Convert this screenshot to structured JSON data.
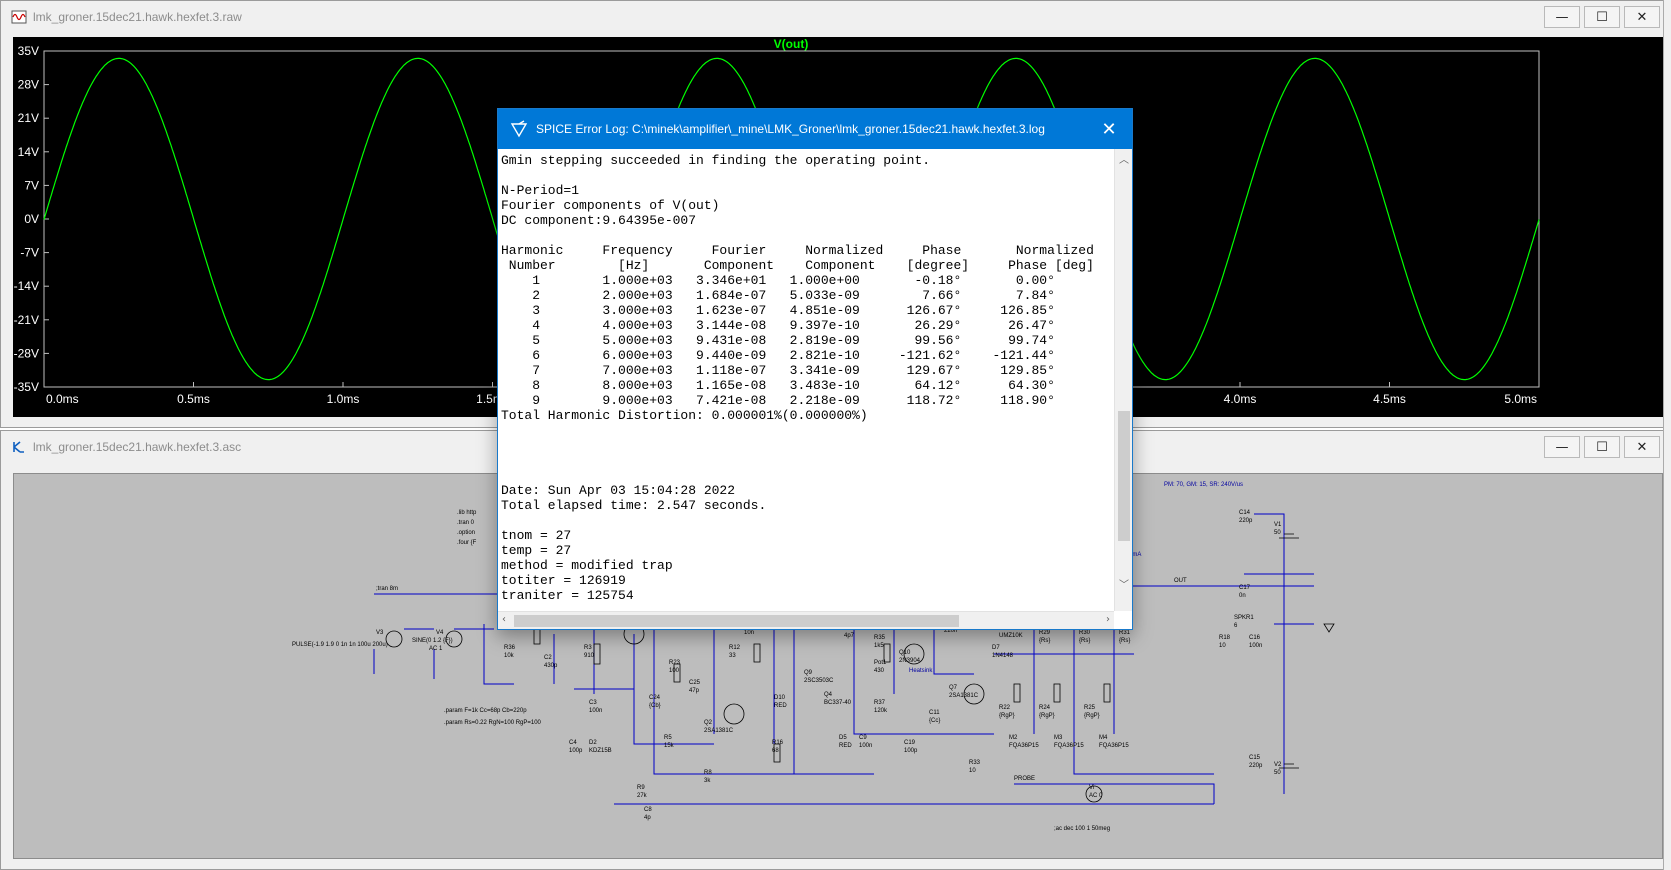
{
  "waveform_window": {
    "title": "lmk_groner.15dec21.hawk.hexfet.3.raw",
    "trace_label": "V(out)",
    "trace_color": "#00ff00",
    "y_ticks": [
      "35V",
      "28V",
      "21V",
      "14V",
      "7V",
      "0V",
      "-7V",
      "-14V",
      "-21V",
      "-28V",
      "-35V"
    ],
    "x_ticks": [
      "0.0ms",
      "0.5ms",
      "1.0ms",
      "1.5ms",
      "2.0ms",
      "2.5ms",
      "3.0ms",
      "3.5ms",
      "4.0ms",
      "4.5ms",
      "5.0ms"
    ]
  },
  "chart_data": {
    "type": "line",
    "title": "V(out)",
    "xlabel": "",
    "ylabel": "",
    "xlim": [
      0,
      5
    ],
    "ylim": [
      -35,
      35
    ],
    "x_unit": "ms",
    "y_unit": "V",
    "series": [
      {
        "name": "V(out)",
        "function": "sine",
        "amplitude": 33.46,
        "frequency_hz": 1000,
        "phase_deg": -0.18,
        "offset": 0,
        "color": "#00ff00"
      }
    ]
  },
  "schematic_window": {
    "title": "lmk_groner.15dec21.hawk.hexfet.3.asc",
    "labels": {
      "info": "PM: 70, GM: 15, SR: 240V/us",
      "tran": ";tran 8m",
      "pulse": "PULSE(-1.9 1.9 0 1n 1n 100u 200u)",
      "sine": "SINE(0 1.2 {F})",
      "ac1": "AC 1",
      "param1": ".param F=1k Cc=68p Cb=220p",
      "param2": ".param Rs=0.22 RgN=100 RgP=100",
      "acdec": ";ac dec 100 1 50meg",
      "out": "OUT",
      "probe": "PROBE",
      "heatsink": "Heatsink",
      "current": "40 mA",
      "lib": ".lib http",
      "tran0": ".tran 0",
      "options": ".option",
      "four": ".four {F"
    },
    "parts": [
      [
        "V3",
        ""
      ],
      [
        "V4",
        ""
      ],
      [
        "R36",
        "10k"
      ],
      [
        "C2",
        "430p"
      ],
      [
        "R3",
        "910"
      ],
      [
        "C3",
        "100n"
      ],
      [
        "C4",
        "100p"
      ],
      [
        "D2",
        "KDZ15B"
      ],
      [
        "Q13",
        "BC550C"
      ],
      [
        "R23",
        "100"
      ],
      [
        "C24",
        "{Cb}"
      ],
      [
        "R5",
        "15k"
      ],
      [
        "Q2",
        "2SA1381C"
      ],
      [
        "R12",
        "33"
      ],
      [
        "C25",
        "47p"
      ],
      [
        "R8",
        "3k"
      ],
      [
        "R9",
        "27k"
      ],
      [
        "C8",
        "4p"
      ],
      [
        "C12",
        "10n"
      ],
      [
        "D10",
        "RED"
      ],
      [
        "R16",
        "68"
      ],
      [
        "Q9",
        "2SC3503C"
      ],
      [
        "Q4",
        "BC337-40"
      ],
      [
        "D5",
        "RED"
      ],
      [
        "C9",
        "100n"
      ],
      [
        "C20",
        "4p7"
      ],
      [
        "R35",
        "1k5"
      ],
      [
        "Pot1",
        "430"
      ],
      [
        "Q5",
        ""
      ],
      [
        "Q10",
        "2N3904"
      ],
      [
        "R37",
        "120k"
      ],
      [
        "C11",
        "{Cc}"
      ],
      [
        "C19",
        "100p"
      ],
      [
        "C23",
        "220n"
      ],
      [
        "Q7",
        "2SA1381C"
      ],
      [
        "R33",
        "10"
      ],
      [
        "D9",
        "UMZ10K"
      ],
      [
        "D7",
        "1N4148"
      ],
      [
        "R29",
        "{Rs}"
      ],
      [
        "R30",
        "{Rs}"
      ],
      [
        "R31",
        "{Rs}"
      ],
      [
        "R22",
        "{RgP}"
      ],
      [
        "R24",
        "{RgP}"
      ],
      [
        "R25",
        "{RgP}"
      ],
      [
        "M2",
        "FQA36P15"
      ],
      [
        "M3",
        "FQA36P15"
      ],
      [
        "M4",
        "FQA36P15"
      ],
      [
        "M6",
        "FQA27N25"
      ],
      [
        "R27",
        "{RgN}"
      ],
      [
        "R28",
        "{Rs}"
      ],
      [
        "C14",
        "220p"
      ],
      [
        "V1",
        "50"
      ],
      [
        "C17",
        "0n"
      ],
      [
        "SPKR1",
        "6"
      ],
      [
        "R18",
        "10"
      ],
      [
        "C16",
        "100n"
      ],
      [
        "C15",
        "220p"
      ],
      [
        "V2",
        "50"
      ],
      [
        "Vi",
        "AC 0"
      ]
    ]
  },
  "error_log": {
    "title": "SPICE Error Log: C:\\minek\\amplifier\\_mine\\LMK_Groner\\lmk_groner.15dec21.hawk.hexfet.3.log",
    "lines": [
      "Gmin stepping succeeded in finding the operating point.",
      "",
      "N-Period=1",
      "Fourier components of V(out)",
      "DC component:9.64395e-007",
      "",
      "Harmonic     Frequency     Fourier     Normalized     Phase       Normalized",
      " Number        [Hz]       Component    Component    [degree]     Phase [deg]",
      "    1        1.000e+03   3.346e+01   1.000e+00       -0.18°       0.00°",
      "    2        2.000e+03   1.684e-07   5.033e-09        7.66°       7.84°",
      "    3        3.000e+03   1.623e-07   4.851e-09      126.67°     126.85°",
      "    4        4.000e+03   3.144e-08   9.397e-10       26.29°      26.47°",
      "    5        5.000e+03   9.431e-08   2.819e-09       99.56°      99.74°",
      "    6        6.000e+03   9.440e-09   2.821e-10     -121.62°    -121.44°",
      "    7        7.000e+03   1.118e-07   3.341e-09      129.67°     129.85°",
      "    8        8.000e+03   1.165e-08   3.483e-10       64.12°      64.30°",
      "    9        9.000e+03   7.421e-08   2.218e-09      118.72°     118.90°",
      "Total Harmonic Distortion: 0.000001%(0.000000%)",
      "",
      "",
      "",
      "",
      "Date: Sun Apr 03 15:04:28 2022",
      "Total elapsed time: 2.547 seconds.",
      "",
      "tnom = 27",
      "temp = 27",
      "method = modified trap",
      "totiter = 126919",
      "traniter = 125754"
    ]
  },
  "window_buttons": {
    "minimize": "—",
    "maximize": "☐",
    "close": "✕"
  }
}
